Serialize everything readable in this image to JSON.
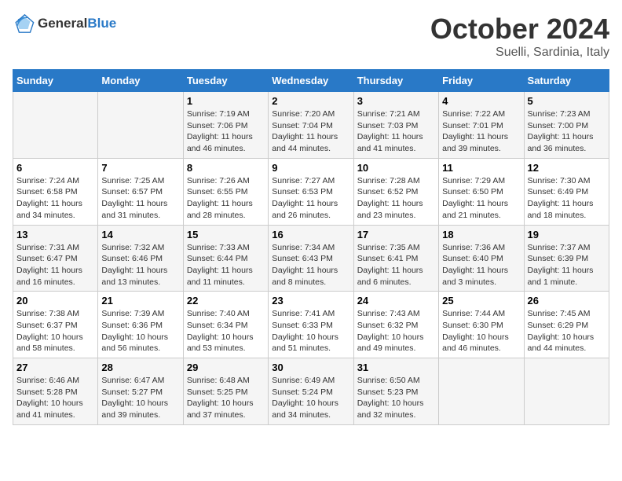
{
  "header": {
    "logo_line1": "General",
    "logo_line2": "Blue",
    "title": "October 2024",
    "subtitle": "Suelli, Sardinia, Italy"
  },
  "days_of_week": [
    "Sunday",
    "Monday",
    "Tuesday",
    "Wednesday",
    "Thursday",
    "Friday",
    "Saturday"
  ],
  "weeks": [
    [
      {
        "num": "",
        "sunrise": "",
        "sunset": "",
        "daylight": ""
      },
      {
        "num": "",
        "sunrise": "",
        "sunset": "",
        "daylight": ""
      },
      {
        "num": "1",
        "sunrise": "Sunrise: 7:19 AM",
        "sunset": "Sunset: 7:06 PM",
        "daylight": "Daylight: 11 hours and 46 minutes."
      },
      {
        "num": "2",
        "sunrise": "Sunrise: 7:20 AM",
        "sunset": "Sunset: 7:04 PM",
        "daylight": "Daylight: 11 hours and 44 minutes."
      },
      {
        "num": "3",
        "sunrise": "Sunrise: 7:21 AM",
        "sunset": "Sunset: 7:03 PM",
        "daylight": "Daylight: 11 hours and 41 minutes."
      },
      {
        "num": "4",
        "sunrise": "Sunrise: 7:22 AM",
        "sunset": "Sunset: 7:01 PM",
        "daylight": "Daylight: 11 hours and 39 minutes."
      },
      {
        "num": "5",
        "sunrise": "Sunrise: 7:23 AM",
        "sunset": "Sunset: 7:00 PM",
        "daylight": "Daylight: 11 hours and 36 minutes."
      }
    ],
    [
      {
        "num": "6",
        "sunrise": "Sunrise: 7:24 AM",
        "sunset": "Sunset: 6:58 PM",
        "daylight": "Daylight: 11 hours and 34 minutes."
      },
      {
        "num": "7",
        "sunrise": "Sunrise: 7:25 AM",
        "sunset": "Sunset: 6:57 PM",
        "daylight": "Daylight: 11 hours and 31 minutes."
      },
      {
        "num": "8",
        "sunrise": "Sunrise: 7:26 AM",
        "sunset": "Sunset: 6:55 PM",
        "daylight": "Daylight: 11 hours and 28 minutes."
      },
      {
        "num": "9",
        "sunrise": "Sunrise: 7:27 AM",
        "sunset": "Sunset: 6:53 PM",
        "daylight": "Daylight: 11 hours and 26 minutes."
      },
      {
        "num": "10",
        "sunrise": "Sunrise: 7:28 AM",
        "sunset": "Sunset: 6:52 PM",
        "daylight": "Daylight: 11 hours and 23 minutes."
      },
      {
        "num": "11",
        "sunrise": "Sunrise: 7:29 AM",
        "sunset": "Sunset: 6:50 PM",
        "daylight": "Daylight: 11 hours and 21 minutes."
      },
      {
        "num": "12",
        "sunrise": "Sunrise: 7:30 AM",
        "sunset": "Sunset: 6:49 PM",
        "daylight": "Daylight: 11 hours and 18 minutes."
      }
    ],
    [
      {
        "num": "13",
        "sunrise": "Sunrise: 7:31 AM",
        "sunset": "Sunset: 6:47 PM",
        "daylight": "Daylight: 11 hours and 16 minutes."
      },
      {
        "num": "14",
        "sunrise": "Sunrise: 7:32 AM",
        "sunset": "Sunset: 6:46 PM",
        "daylight": "Daylight: 11 hours and 13 minutes."
      },
      {
        "num": "15",
        "sunrise": "Sunrise: 7:33 AM",
        "sunset": "Sunset: 6:44 PM",
        "daylight": "Daylight: 11 hours and 11 minutes."
      },
      {
        "num": "16",
        "sunrise": "Sunrise: 7:34 AM",
        "sunset": "Sunset: 6:43 PM",
        "daylight": "Daylight: 11 hours and 8 minutes."
      },
      {
        "num": "17",
        "sunrise": "Sunrise: 7:35 AM",
        "sunset": "Sunset: 6:41 PM",
        "daylight": "Daylight: 11 hours and 6 minutes."
      },
      {
        "num": "18",
        "sunrise": "Sunrise: 7:36 AM",
        "sunset": "Sunset: 6:40 PM",
        "daylight": "Daylight: 11 hours and 3 minutes."
      },
      {
        "num": "19",
        "sunrise": "Sunrise: 7:37 AM",
        "sunset": "Sunset: 6:39 PM",
        "daylight": "Daylight: 11 hours and 1 minute."
      }
    ],
    [
      {
        "num": "20",
        "sunrise": "Sunrise: 7:38 AM",
        "sunset": "Sunset: 6:37 PM",
        "daylight": "Daylight: 10 hours and 58 minutes."
      },
      {
        "num": "21",
        "sunrise": "Sunrise: 7:39 AM",
        "sunset": "Sunset: 6:36 PM",
        "daylight": "Daylight: 10 hours and 56 minutes."
      },
      {
        "num": "22",
        "sunrise": "Sunrise: 7:40 AM",
        "sunset": "Sunset: 6:34 PM",
        "daylight": "Daylight: 10 hours and 53 minutes."
      },
      {
        "num": "23",
        "sunrise": "Sunrise: 7:41 AM",
        "sunset": "Sunset: 6:33 PM",
        "daylight": "Daylight: 10 hours and 51 minutes."
      },
      {
        "num": "24",
        "sunrise": "Sunrise: 7:43 AM",
        "sunset": "Sunset: 6:32 PM",
        "daylight": "Daylight: 10 hours and 49 minutes."
      },
      {
        "num": "25",
        "sunrise": "Sunrise: 7:44 AM",
        "sunset": "Sunset: 6:30 PM",
        "daylight": "Daylight: 10 hours and 46 minutes."
      },
      {
        "num": "26",
        "sunrise": "Sunrise: 7:45 AM",
        "sunset": "Sunset: 6:29 PM",
        "daylight": "Daylight: 10 hours and 44 minutes."
      }
    ],
    [
      {
        "num": "27",
        "sunrise": "Sunrise: 6:46 AM",
        "sunset": "Sunset: 5:28 PM",
        "daylight": "Daylight: 10 hours and 41 minutes."
      },
      {
        "num": "28",
        "sunrise": "Sunrise: 6:47 AM",
        "sunset": "Sunset: 5:27 PM",
        "daylight": "Daylight: 10 hours and 39 minutes."
      },
      {
        "num": "29",
        "sunrise": "Sunrise: 6:48 AM",
        "sunset": "Sunset: 5:25 PM",
        "daylight": "Daylight: 10 hours and 37 minutes."
      },
      {
        "num": "30",
        "sunrise": "Sunrise: 6:49 AM",
        "sunset": "Sunset: 5:24 PM",
        "daylight": "Daylight: 10 hours and 34 minutes."
      },
      {
        "num": "31",
        "sunrise": "Sunrise: 6:50 AM",
        "sunset": "Sunset: 5:23 PM",
        "daylight": "Daylight: 10 hours and 32 minutes."
      },
      {
        "num": "",
        "sunrise": "",
        "sunset": "",
        "daylight": ""
      },
      {
        "num": "",
        "sunrise": "",
        "sunset": "",
        "daylight": ""
      }
    ]
  ]
}
